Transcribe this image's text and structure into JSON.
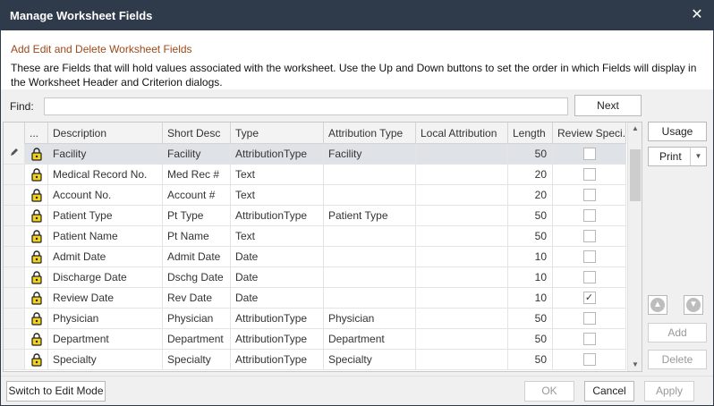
{
  "window": {
    "title": "Manage Worksheet Fields",
    "close_glyph": "✕"
  },
  "header": {
    "title": "Add Edit and Delete Worksheet Fields",
    "description": "These are Fields that will hold values associated with the worksheet. Use the Up and Down buttons to set the order in which Fields will display in the Worksheet Header and Criterion dialogs."
  },
  "find": {
    "label": "Find:",
    "value": "",
    "placeholder": "",
    "next_label": "Next"
  },
  "grid": {
    "columns": [
      "...",
      "Description",
      "Short Desc",
      "Type",
      "Attribution Type",
      "Local Attribution",
      "Length",
      "Review Speci..."
    ],
    "selected_index": 0,
    "rows": [
      {
        "description": "Facility",
        "short_desc": "Facility",
        "type": "AttributionType",
        "attribution_type": "Facility",
        "local_attribution": "",
        "length": "50",
        "review": false
      },
      {
        "description": "Medical Record No.",
        "short_desc": "Med Rec #",
        "type": "Text",
        "attribution_type": "",
        "local_attribution": "",
        "length": "20",
        "review": false
      },
      {
        "description": "Account No.",
        "short_desc": "Account #",
        "type": "Text",
        "attribution_type": "",
        "local_attribution": "",
        "length": "20",
        "review": false
      },
      {
        "description": "Patient Type",
        "short_desc": "Pt Type",
        "type": "AttributionType",
        "attribution_type": "Patient Type",
        "local_attribution": "",
        "length": "50",
        "review": false
      },
      {
        "description": "Patient Name",
        "short_desc": "Pt Name",
        "type": "Text",
        "attribution_type": "",
        "local_attribution": "",
        "length": "50",
        "review": false
      },
      {
        "description": "Admit Date",
        "short_desc": "Admit Date",
        "type": "Date",
        "attribution_type": "",
        "local_attribution": "",
        "length": "10",
        "review": false
      },
      {
        "description": "Discharge Date",
        "short_desc": "Dschg Date",
        "type": "Date",
        "attribution_type": "",
        "local_attribution": "",
        "length": "10",
        "review": false
      },
      {
        "description": "Review Date",
        "short_desc": "Rev Date",
        "type": "Date",
        "attribution_type": "",
        "local_attribution": "",
        "length": "10",
        "review": true
      },
      {
        "description": "Physician",
        "short_desc": "Physician",
        "type": "AttributionType",
        "attribution_type": "Physician",
        "local_attribution": "",
        "length": "50",
        "review": false
      },
      {
        "description": "Department",
        "short_desc": "Department",
        "type": "AttributionType",
        "attribution_type": "Department",
        "local_attribution": "",
        "length": "50",
        "review": false
      },
      {
        "description": "Specialty",
        "short_desc": "Specialty",
        "type": "AttributionType",
        "attribution_type": "Specialty",
        "local_attribution": "",
        "length": "50",
        "review": false
      }
    ]
  },
  "side_buttons": {
    "usage": "Usage",
    "print": "Print",
    "add": "Add",
    "delete": "Delete"
  },
  "footer": {
    "switch_mode": "Switch to Edit Mode",
    "ok": "OK",
    "cancel": "Cancel",
    "apply": "Apply"
  },
  "colors": {
    "title_bar": "#2f3a4a",
    "header_title": "#9c4a1a",
    "selected_row": "#dfe3e8"
  }
}
